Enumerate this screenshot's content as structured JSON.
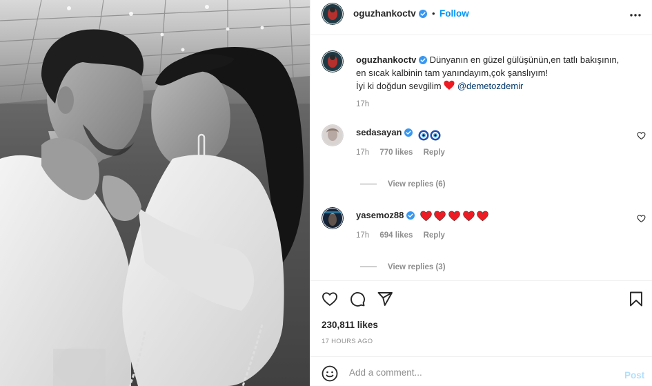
{
  "photo": {
    "alt": "Black and white photo of a couple embracing"
  },
  "header": {
    "username": "oguzhankoctv",
    "separator": "•",
    "follow_label": "Follow",
    "more_icon": "more-horizontal-icon"
  },
  "caption": {
    "username": "oguzhankoctv",
    "line1": "Dünyanın en güzel gülüşünün,en tatlı bakışının,",
    "line2": "en sıcak kalbinin tam yanındayım,çok şanslıyım!",
    "line3": "İyi ki doğdun sevgilim",
    "mention": "@demetozdemir",
    "time": "17h"
  },
  "comments": [
    {
      "username": "sedasayan",
      "emoji": [
        "nazar-eye",
        "nazar-eye"
      ],
      "time": "17h",
      "likes": "770 likes",
      "reply_label": "Reply",
      "view_replies": "View replies (6)"
    },
    {
      "username": "yasemoz88",
      "emoji": [
        "red-heart",
        "red-heart",
        "red-heart",
        "red-heart",
        "red-heart"
      ],
      "time": "17h",
      "likes": "694 likes",
      "reply_label": "Reply",
      "view_replies": "View replies (3)"
    }
  ],
  "actions": {
    "likes": "230,811 likes",
    "posted": "17 HOURS AGO"
  },
  "add_comment": {
    "placeholder": "Add a comment...",
    "post_label": "Post"
  },
  "colors": {
    "link": "#0095f6",
    "mention": "#00376b",
    "verified": "#3897f0",
    "heart": "#ed1c24",
    "muted": "#8e8e8e",
    "post_disabled": "#b2dffc"
  }
}
